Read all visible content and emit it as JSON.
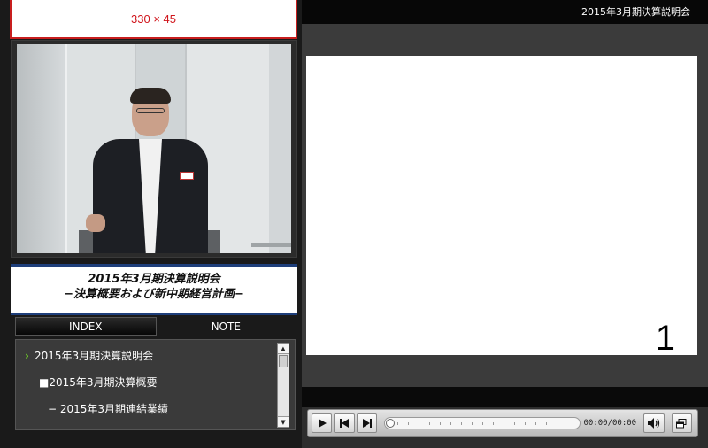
{
  "banner": {
    "text": "330 × 45"
  },
  "event": {
    "window_title": "2015年3月期決算説明会",
    "title_line1": "2015年3月期決算説明会",
    "title_line2": "−決算概要および新中期経営計画−"
  },
  "tabs": [
    {
      "label": "INDEX",
      "active": true
    },
    {
      "label": "NOTE",
      "active": false
    }
  ],
  "index": {
    "items": [
      {
        "label": "2015年3月期決算説明会",
        "selected": true
      },
      {
        "label": "■2015年3月期決算概要"
      },
      {
        "label": "− 2015年3月期連結業績"
      }
    ]
  },
  "slide": {
    "page_number": "1"
  },
  "player": {
    "timecode": "00:00/00:00",
    "icons": [
      "play-icon",
      "previous-icon",
      "next-icon",
      "volume-icon",
      "popout-icon"
    ]
  },
  "colors": {
    "banner_border": "#c81e1e",
    "banner_text": "#d0141b",
    "title_bar": "#1e3e7a",
    "chevron": "#6bc22a"
  }
}
